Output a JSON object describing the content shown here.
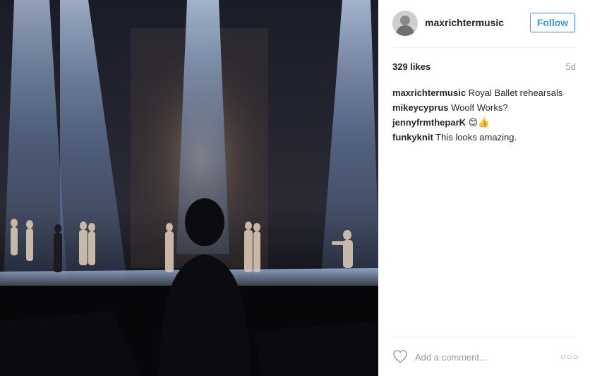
{
  "post": {
    "image_alt": "Dancers on a spotlit stage with a silhouetted figure in the foreground"
  },
  "header": {
    "username": "maxrichtermusic",
    "follow_label": "Follow"
  },
  "stats": {
    "likes": "329 likes",
    "age": "5d"
  },
  "comments": [
    {
      "user": "maxrichtermusic",
      "text": " Royal Ballet rehearsals"
    },
    {
      "user": "mikeycyprus",
      "text": " Woolf Works?"
    },
    {
      "user": "jennyfrmtheparK",
      "text": " 😊👍"
    },
    {
      "user": "funkyknit",
      "text": " This looks amazing."
    }
  ],
  "footer": {
    "comment_placeholder": "Add a comment...",
    "more_label": "○○○"
  },
  "colors": {
    "accent": "#3897f0",
    "text": "#262626",
    "muted": "#999999"
  }
}
